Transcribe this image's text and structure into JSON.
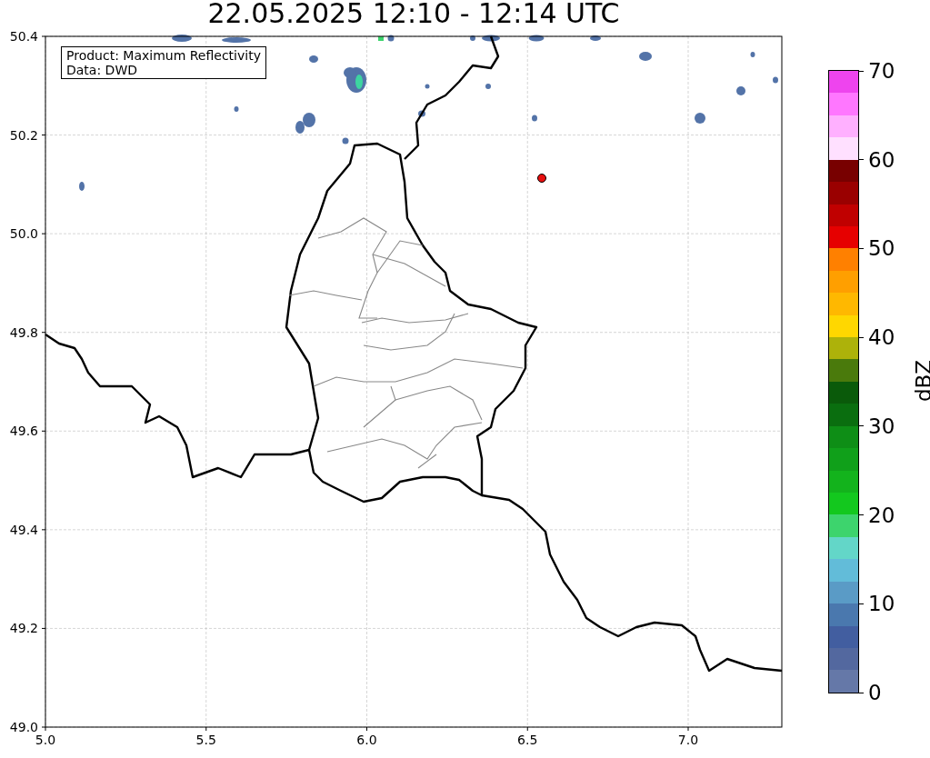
{
  "title": "22.05.2025 12:10 - 12:14 UTC",
  "info_box": {
    "lines": [
      "Product: Maximum Reflectivity",
      "Data: DWD"
    ]
  },
  "x_ticks": [
    "5.0",
    "5.5",
    "6.0",
    "6.5",
    "7.0"
  ],
  "y_ticks": [
    "50.4",
    "50.2",
    "50.0",
    "49.8",
    "49.6",
    "49.4",
    "49.2",
    "49.0"
  ],
  "colorbar": {
    "label": "dBZ",
    "ticks": [
      "70",
      "60",
      "50",
      "40",
      "30",
      "20",
      "10",
      "0"
    ],
    "segments": [
      {
        "color": "#ee44ee"
      },
      {
        "color": "#ff77ff"
      },
      {
        "color": "#ffb0ff"
      },
      {
        "color": "#ffe0ff"
      },
      {
        "color": "#780000"
      },
      {
        "color": "#9a0000"
      },
      {
        "color": "#c00000"
      },
      {
        "color": "#e60000"
      },
      {
        "color": "#ff8000"
      },
      {
        "color": "#ff9f00"
      },
      {
        "color": "#ffb800"
      },
      {
        "color": "#ffd700"
      },
      {
        "color": "#adb20a"
      },
      {
        "color": "#4a7a0c"
      },
      {
        "color": "#0a5a0a"
      },
      {
        "color": "#0a6e0f"
      },
      {
        "color": "#0e8e16"
      },
      {
        "color": "#10a01a"
      },
      {
        "color": "#13b31c"
      },
      {
        "color": "#13c81e"
      },
      {
        "color": "#3dd46d"
      },
      {
        "color": "#63d6c8"
      },
      {
        "color": "#62bcd9"
      },
      {
        "color": "#5a9bc6"
      },
      {
        "color": "#4a78ae"
      },
      {
        "color": "#425ea0"
      },
      {
        "color": "#53689f"
      },
      {
        "color": "#6578a8"
      }
    ]
  }
}
